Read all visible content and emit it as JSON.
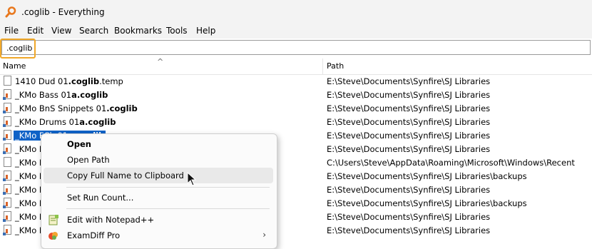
{
  "window": {
    "title": ".coglib - Everything",
    "app_icon": "magnifier-orange-icon"
  },
  "menu": [
    "File",
    "Edit",
    "View",
    "Search",
    "Bookmarks",
    "Tools",
    "Help"
  ],
  "search": {
    "value": ".coglib"
  },
  "columns": {
    "name": "Name",
    "path": "Path"
  },
  "rows": [
    {
      "name_pre": "1410 Dud 01",
      "name_bold": ".coglib",
      "name_post": ".temp",
      "path": "E:\\Steve\\Documents\\Synfire\\SJ Libraries",
      "icon": "blank-file-icon"
    },
    {
      "name_pre": "_KMo Bass 01",
      "name_bold": "a.coglib",
      "name_post": "",
      "path": "E:\\Steve\\Documents\\Synfire\\SJ Libraries",
      "icon": "coglib-file-icon"
    },
    {
      "name_pre": "_KMo BnS Snippets 01",
      "name_bold": ".coglib",
      "name_post": "",
      "path": "E:\\Steve\\Documents\\Synfire\\SJ Libraries",
      "icon": "coglib-file-icon"
    },
    {
      "name_pre": "_KMo Drums 01",
      "name_bold": "a.coglib",
      "name_post": "",
      "path": "E:\\Steve\\Documents\\Synfire\\SJ Libraries",
      "icon": "coglib-file-icon"
    },
    {
      "name_pre": "_KMo FCh 01",
      "name_bold": "a.coglib",
      "name_post": "",
      "path": "E:\\Steve\\Documents\\Synfire\\SJ Libraries",
      "icon": "coglib-file-icon",
      "selected": true
    },
    {
      "name_pre": "_KMo I",
      "name_bold": "",
      "name_post": "",
      "path": "E:\\Steve\\Documents\\Synfire\\SJ Libraries",
      "icon": "coglib-file-icon"
    },
    {
      "name_pre": "_KMo I",
      "name_bold": "",
      "name_post": "",
      "path": "C:\\Users\\Steve\\AppData\\Roaming\\Microsoft\\Windows\\Recent",
      "icon": "shortcut-file-icon"
    },
    {
      "name_pre": "_KMo I",
      "name_bold": "",
      "name_post": "",
      "path": "E:\\Steve\\Documents\\Synfire\\SJ Libraries\\backups",
      "icon": "coglib-file-icon"
    },
    {
      "name_pre": "_KMo I",
      "name_bold": "",
      "name_post": "",
      "path": "E:\\Steve\\Documents\\Synfire\\SJ Libraries",
      "icon": "coglib-file-icon"
    },
    {
      "name_pre": "_KMo I",
      "name_bold": "",
      "name_post": "",
      "path": "E:\\Steve\\Documents\\Synfire\\SJ Libraries\\backups",
      "icon": "coglib-file-icon"
    },
    {
      "name_pre": "_KMo I",
      "name_bold": "",
      "name_post": "",
      "path": "E:\\Steve\\Documents\\Synfire\\SJ Libraries",
      "icon": "coglib-file-icon"
    },
    {
      "name_pre": "_KMo I",
      "name_bold": "",
      "name_post": "",
      "path": "E:\\Steve\\Documents\\Synfire\\SJ Libraries",
      "icon": "coglib-file-icon"
    }
  ],
  "context_menu": {
    "open": "Open",
    "open_path": "Open Path",
    "copy_full_name": "Copy Full Name to Clipboard",
    "set_run_count": "Set Run Count...",
    "edit_notepad": "Edit with Notepad++",
    "examdiff": "ExamDiff Pro"
  },
  "colors": {
    "selection": "#0f62c7",
    "search_highlight": "#f0a82a"
  }
}
